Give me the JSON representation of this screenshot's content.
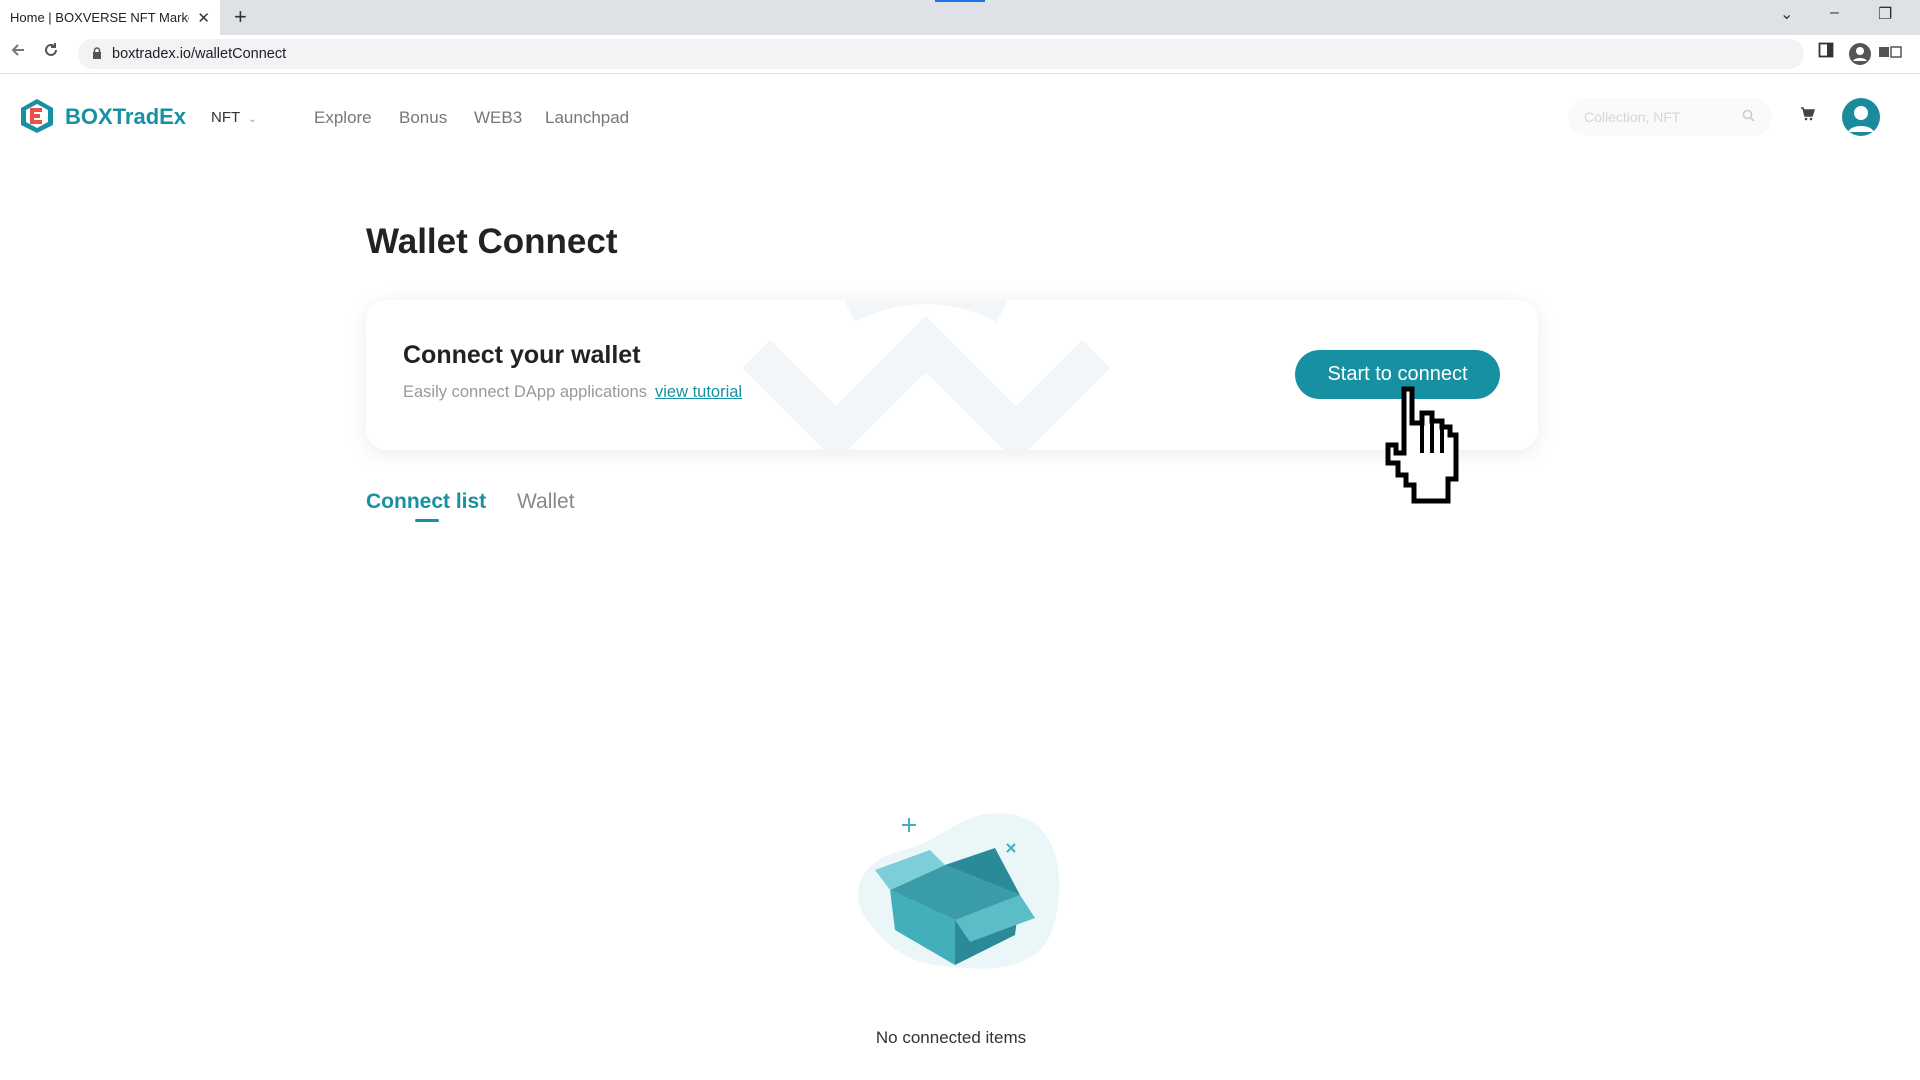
{
  "browser": {
    "tab_title": "Home | BOXVERSE NFT Market",
    "tab_close": "✕",
    "new_tab": "+",
    "url": "boxtradex.io/walletConnect",
    "window_controls": {
      "tab_search": "⌄",
      "minimize": "–",
      "restore": "❐"
    }
  },
  "header": {
    "brand": "BOXTradEx",
    "category_select": "NFT",
    "nav": [
      "Explore",
      "Bonus",
      "WEB3",
      "Launchpad"
    ],
    "search_placeholder": "Collection, NFT"
  },
  "page": {
    "title": "Wallet Connect",
    "card": {
      "heading": "Connect your wallet",
      "subtitle": "Easily connect DApp applications",
      "tutorial_link": "view tutorial",
      "button": "Start to connect"
    },
    "tabs": [
      {
        "label": "Connect list",
        "active": true
      },
      {
        "label": "Wallet",
        "active": false
      }
    ],
    "empty_text": "No connected items"
  },
  "colors": {
    "accent": "#1791a2",
    "box_teal": "#43afbb",
    "box_dark": "#2a8a97",
    "bubble": "#eaf6f8"
  },
  "icons": [
    "back-arrow-icon",
    "reload-icon",
    "lock-icon",
    "sidebar-icon",
    "profile-icon",
    "chevron-down-icon",
    "search-icon",
    "cart-icon",
    "user-avatar-icon",
    "hand-cursor-icon",
    "open-box-icon"
  ]
}
